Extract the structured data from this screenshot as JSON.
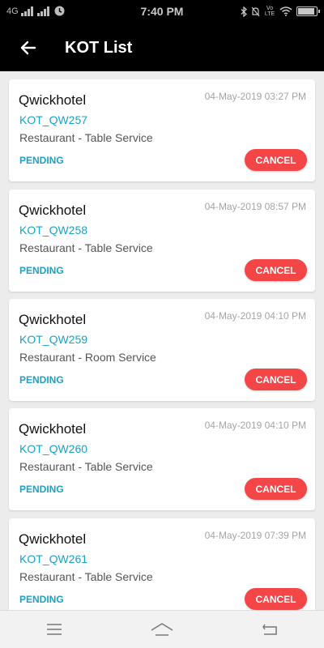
{
  "status_bar": {
    "network": "4G",
    "time": "7:40 PM",
    "volte": "Vo LTE"
  },
  "app_bar": {
    "title": "KOT List"
  },
  "kots": [
    {
      "hotel": "Qwickhotel",
      "date": "04-May-2019 03:27 PM",
      "code": "KOT_QW257",
      "service": "Restaurant - Table Service",
      "status": "PENDING",
      "action": "CANCEL"
    },
    {
      "hotel": "Qwickhotel",
      "date": "04-May-2019 08:57 PM",
      "code": "KOT_QW258",
      "service": "Restaurant - Table Service",
      "status": "PENDING",
      "action": "CANCEL"
    },
    {
      "hotel": "Qwickhotel",
      "date": "04-May-2019 04:10 PM",
      "code": "KOT_QW259",
      "service": "Restaurant - Room Service",
      "status": "PENDING",
      "action": "CANCEL"
    },
    {
      "hotel": "Qwickhotel",
      "date": "04-May-2019 04:10 PM",
      "code": "KOT_QW260",
      "service": "Restaurant - Table Service",
      "status": "PENDING",
      "action": "CANCEL"
    },
    {
      "hotel": "Qwickhotel",
      "date": "04-May-2019 07:39 PM",
      "code": "KOT_QW261",
      "service": "Restaurant - Table Service",
      "status": "PENDING",
      "action": "CANCEL"
    }
  ],
  "colors": {
    "accent": "#1aa2c9",
    "cancel": "#f44646",
    "header": "#000000"
  }
}
